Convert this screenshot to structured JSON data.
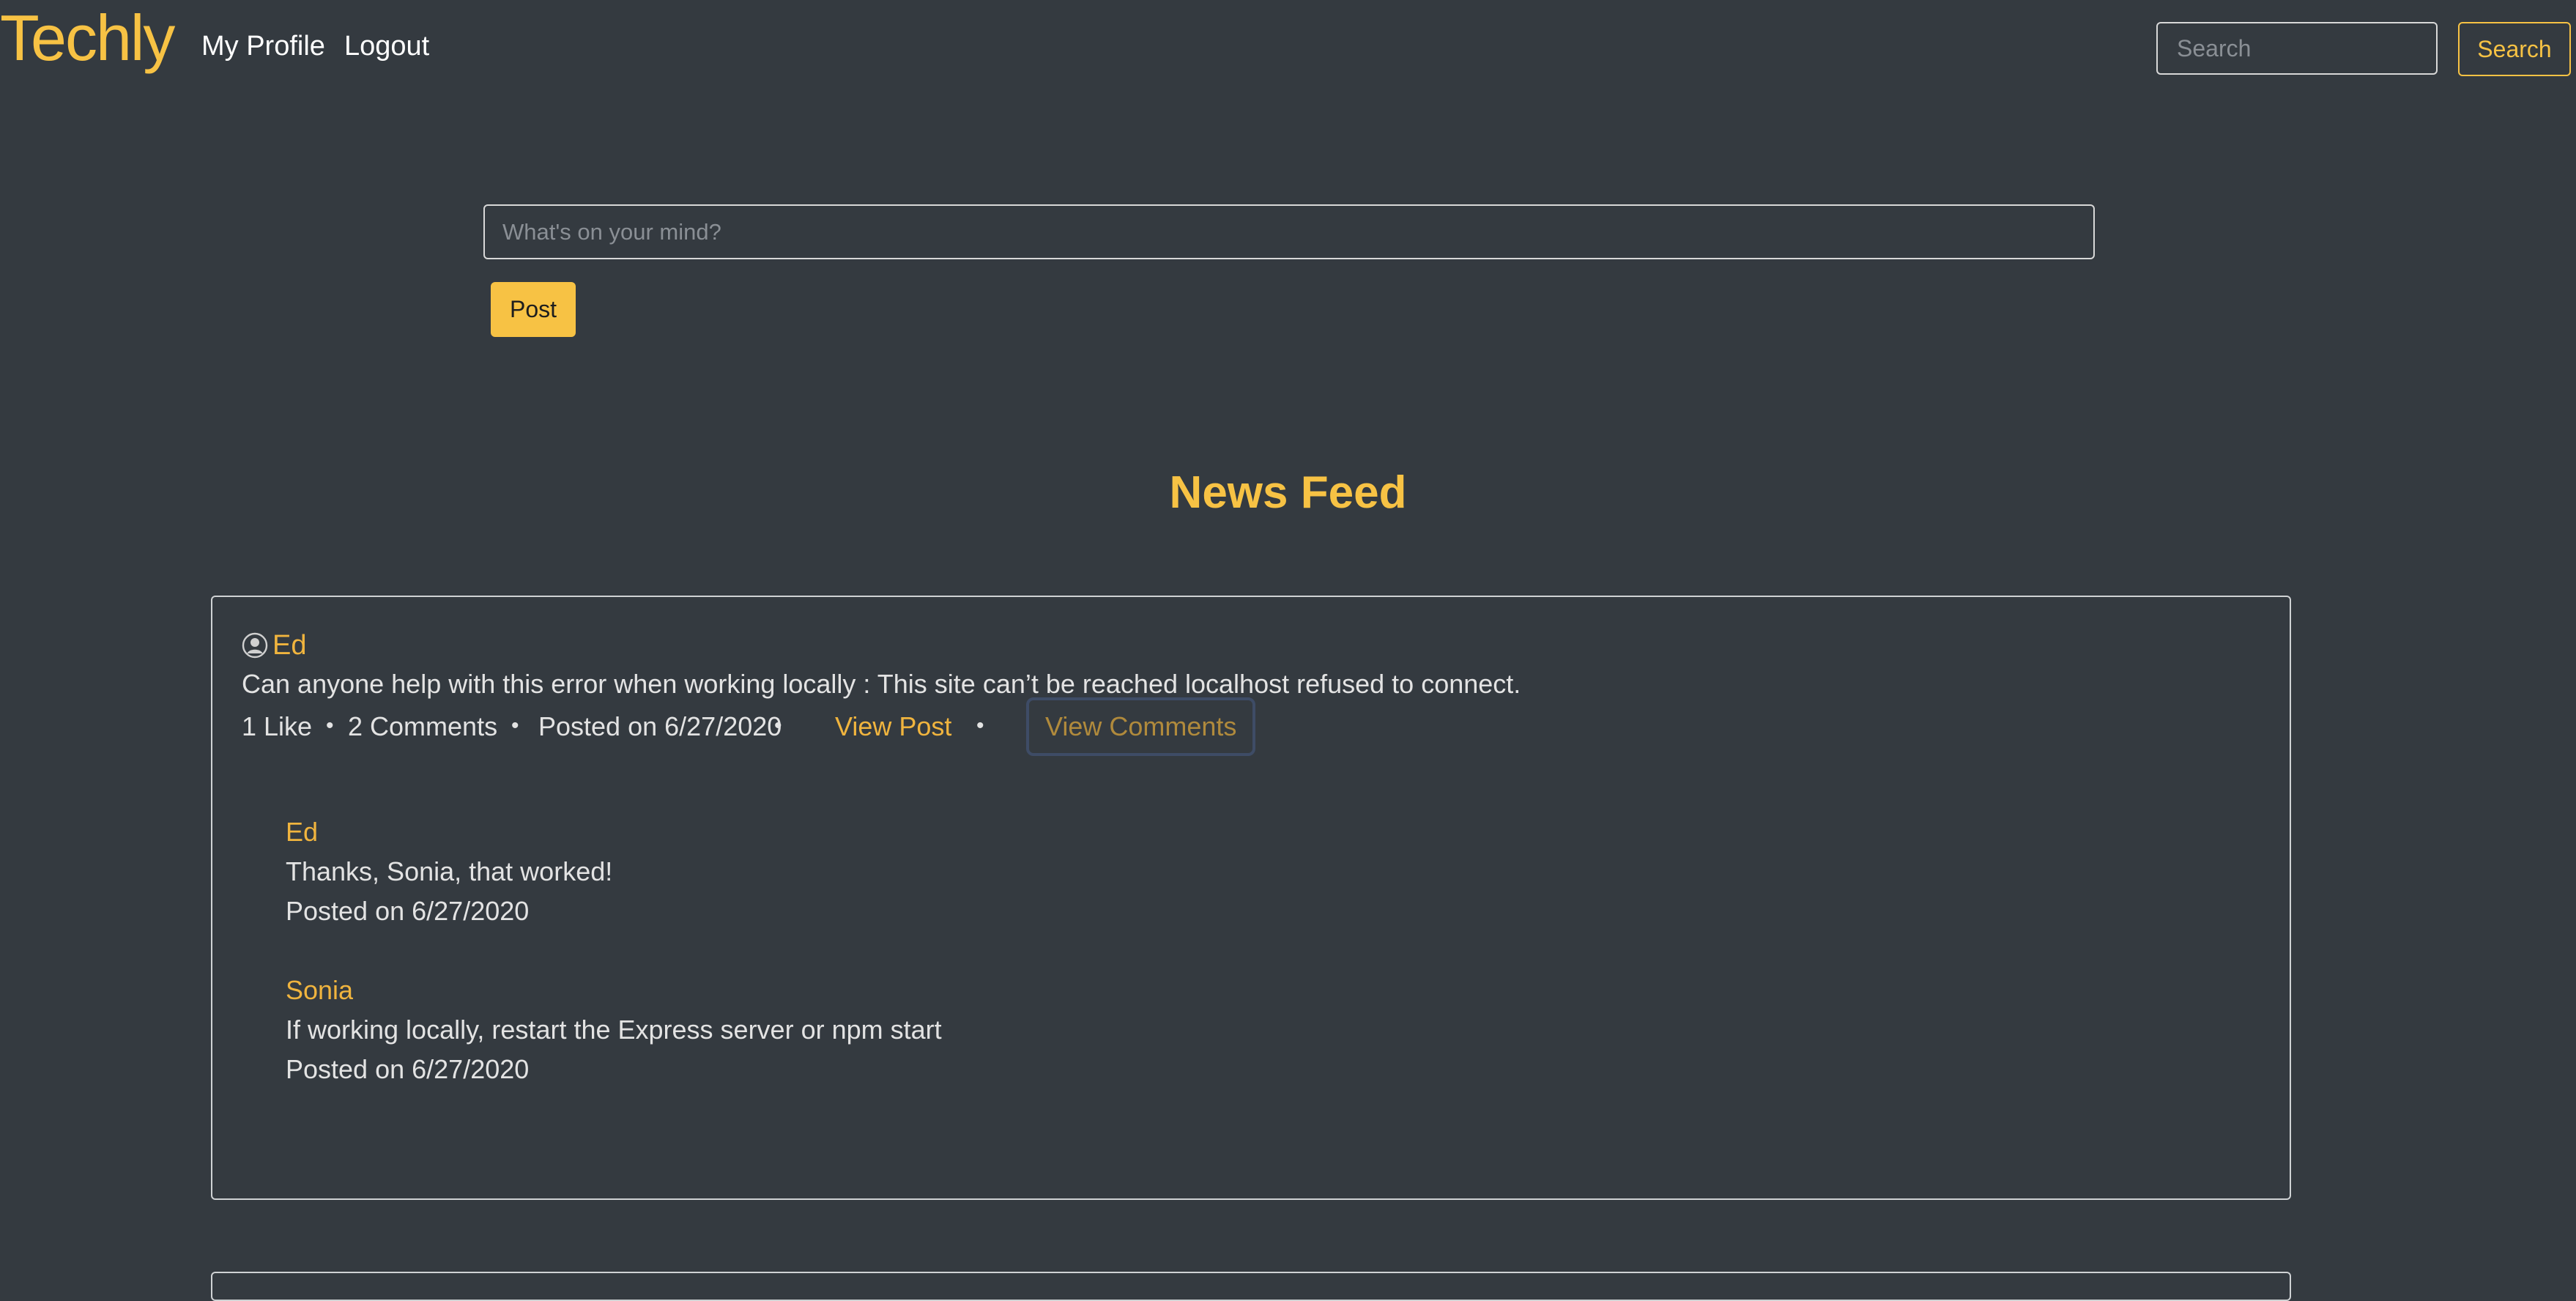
{
  "nav": {
    "brand": "Techly",
    "my_profile": "My Profile",
    "logout": "Logout",
    "search_placeholder": "Search",
    "search_button": "Search"
  },
  "composer": {
    "placeholder": "What's on your mind?",
    "post_button": "Post"
  },
  "feed": {
    "title": "News Feed",
    "posts": [
      {
        "author": "Ed",
        "body": "Can anyone help with this error when working locally : This site can’t be reached localhost refused to connect.",
        "likes": "1 Like",
        "comments_count": "2 Comments",
        "posted": "Posted on 6/27/2020",
        "view_post": "View Post",
        "view_comments": "View Comments",
        "comments": [
          {
            "author": "Ed",
            "text": "Thanks, Sonia, that worked!",
            "posted": "Posted on 6/27/2020"
          },
          {
            "author": "Sonia",
            "text": "If working locally, restart the Express server or npm start",
            "posted": "Posted on 6/27/2020"
          }
        ]
      }
    ]
  },
  "colors": {
    "background": "#343a40",
    "accent": "#f7c244",
    "text": "#e3e3e3"
  },
  "icons": {
    "author": "user-circle-icon"
  }
}
